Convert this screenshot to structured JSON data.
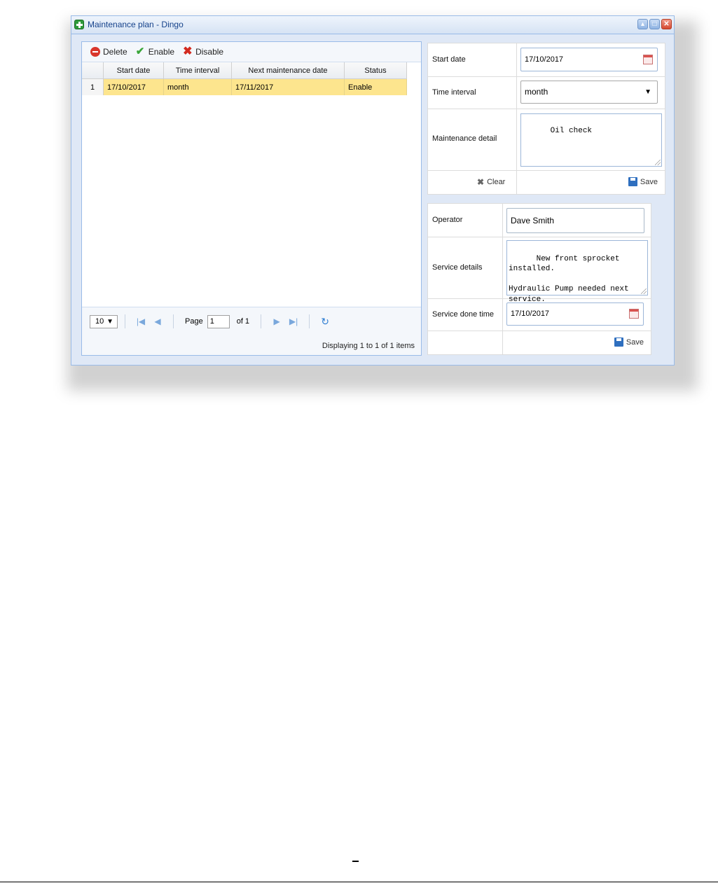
{
  "window": {
    "title": "Maintenance plan - Dingo",
    "buttons": [
      "▴",
      "□",
      "✕"
    ]
  },
  "toolbar": {
    "delete_label": "Delete",
    "enable_label": "Enable",
    "disable_label": "Disable"
  },
  "grid": {
    "columns": [
      "Start date",
      "Time interval",
      "Next maintenance date",
      "Status"
    ],
    "rows": [
      {
        "num": "1",
        "start_date": "17/10/2017",
        "time_interval": "month",
        "next_date": "17/11/2017",
        "status": "Enable"
      }
    ]
  },
  "pager": {
    "page_size": "10",
    "page_label": "Page",
    "page_value": "1",
    "of_label": "of 1",
    "displaying": "Displaying 1 to 1 of 1 items"
  },
  "plan_form": {
    "start_date_label": "Start date",
    "start_date_value": "17/10/2017",
    "time_interval_label": "Time interval",
    "time_interval_value": "month",
    "detail_label": "Maintenance detail",
    "detail_value": "Oil check",
    "clear_label": "Clear",
    "save_label": "Save"
  },
  "service_form": {
    "operator_label": "Operator",
    "operator_value": "Dave Smith",
    "details_label": "Service details",
    "details_value": "New front sprocket installed.\n\nHydraulic Pump needed next service.",
    "done_time_label": "Service done time",
    "done_time_value": "17/10/2017",
    "save_label": "Save"
  },
  "colors": {
    "selected_row": "#fde58e",
    "window_border": "#99bbe8",
    "title_text": "#15428b"
  }
}
